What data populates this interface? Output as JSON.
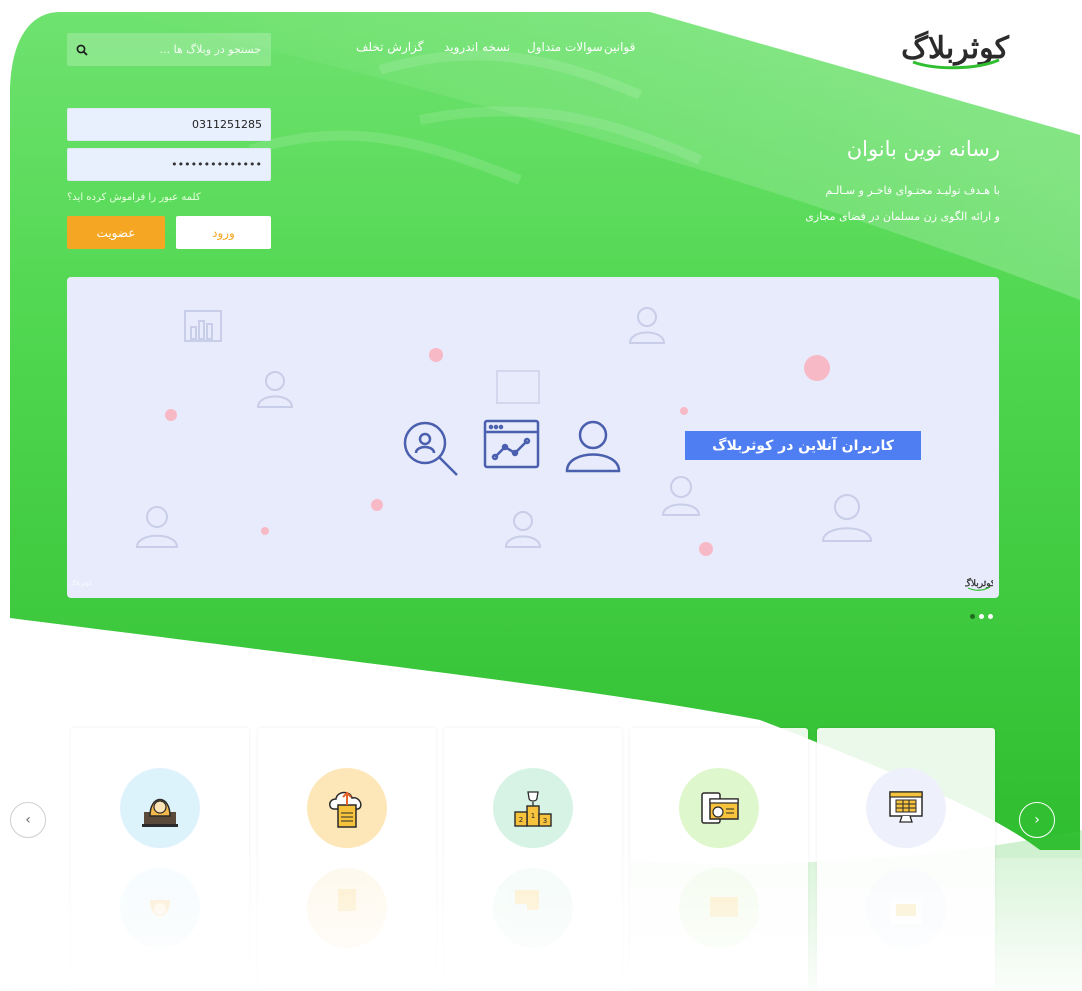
{
  "brand": {
    "logo_text": "کوثربلاگ",
    "primary_color": "#32c832",
    "light_green": "#7fe27f",
    "accent_orange": "#f5a623",
    "caption_blue": "#4e7ef2"
  },
  "nav": {
    "items": [
      {
        "label": "قوانین"
      },
      {
        "label": "سوالات متداول"
      },
      {
        "label": "نسخه اندروید"
      },
      {
        "label": "گزارش تخلف"
      }
    ]
  },
  "search": {
    "placeholder": "جستجو در وبلاگ ها ...",
    "icon": "search-icon"
  },
  "login": {
    "username_value": "0311251285",
    "password_mask": "••••••••••••••",
    "forgot_label": "کلمه عبور را فراموش کرده اید؟",
    "login_label": "ورود",
    "signup_label": "عضویت"
  },
  "hero": {
    "title": "رسانه نوین بانوان",
    "line1": "با هـدف تولیـد محتـوای فاخـر و سـالـم",
    "line2": "و ارائه الگوی زن مسلمان در فضای مجازی"
  },
  "slider": {
    "caption": "کاربران آنلاین در کوثربلاگ",
    "watermark": "کوثربلاگ",
    "active_slide": 1,
    "slide_count": 3
  },
  "cards": [
    {
      "icon": "computer-table-icon",
      "color": "#eef0fb"
    },
    {
      "icon": "monitor-chart-icon",
      "color": "#dff7cc"
    },
    {
      "icon": "podium-trophy-icon",
      "color": "#d7f3e6"
    },
    {
      "icon": "cloud-upload-document-icon",
      "color": "#fde7b8"
    },
    {
      "icon": "woman-avatar-icon",
      "color": "#ddf3fb"
    }
  ],
  "carousel": {
    "prev_icon": "chevron-left-icon",
    "next_icon": "chevron-right-icon"
  }
}
